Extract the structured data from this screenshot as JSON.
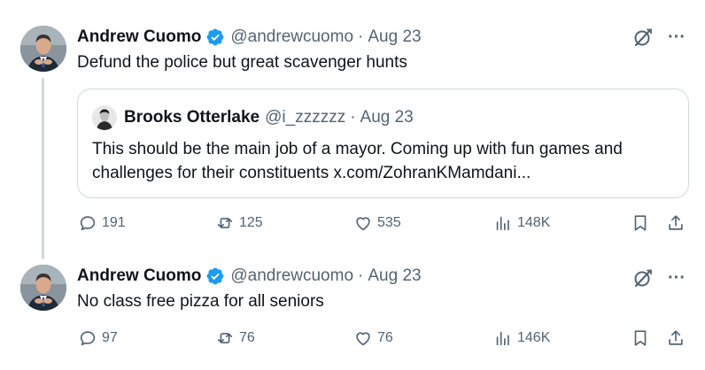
{
  "thread": [
    {
      "author_name": "Andrew Cuomo",
      "handle": "@andrewcuomo",
      "separator": "·",
      "date": "Aug 23",
      "text": "Defund the police but great scavenger hunts",
      "quote": {
        "author_name": "Brooks Otterlake",
        "handle": "@i_zzzzzz",
        "separator": "·",
        "date": "Aug 23",
        "text": "This should be the main job of a mayor. Coming up with fun games and challenges for their constituents x.com/ZohranKMamdani..."
      },
      "stats": {
        "replies": "191",
        "reposts": "125",
        "likes": "535",
        "views": "148K"
      }
    },
    {
      "author_name": "Andrew Cuomo",
      "handle": "@andrewcuomo",
      "separator": "·",
      "date": "Aug 23",
      "text": "No class free pizza for all seniors",
      "stats": {
        "replies": "97",
        "reposts": "76",
        "likes": "76",
        "views": "146K"
      }
    }
  ],
  "icons": {
    "verified": "verified-badge-icon",
    "grok": "grok-icon",
    "more": "more-icon",
    "more_glyph": "···",
    "reply": "reply-icon",
    "repost": "repost-icon",
    "like": "like-icon",
    "views": "views-icon",
    "bookmark": "bookmark-icon",
    "share": "share-icon"
  },
  "colors": {
    "verified_blue": "#1d9bf0",
    "text_primary": "#0f1419",
    "text_secondary": "#536471",
    "border": "#cfd9de"
  }
}
